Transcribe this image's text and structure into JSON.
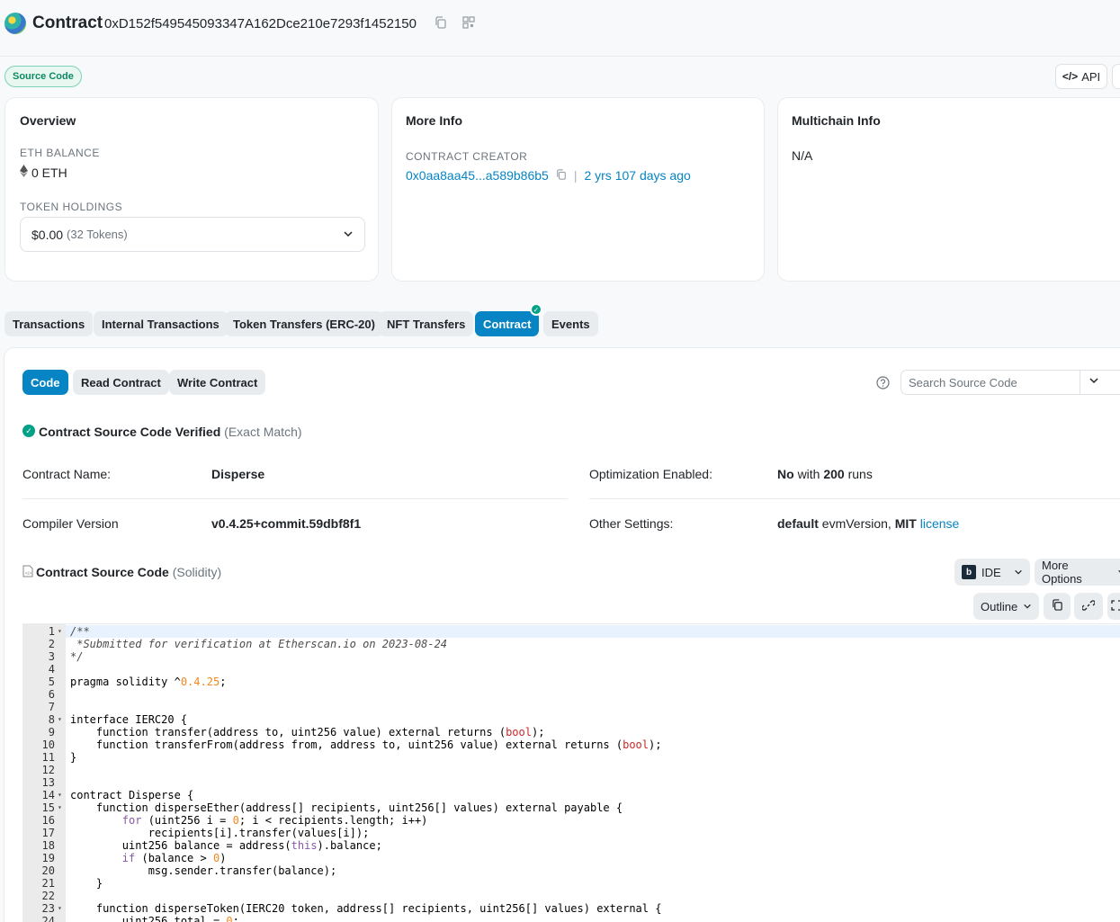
{
  "header": {
    "title": "Contract",
    "address": "0xD152f549545093347A162Dce210e7293f1452150"
  },
  "badge": {
    "source_code": "Source Code"
  },
  "api_button": {
    "label": "API"
  },
  "overview": {
    "title": "Overview",
    "eth_balance_label": "ETH BALANCE",
    "eth_balance_value": "0 ETH",
    "token_holdings_label": "TOKEN HOLDINGS",
    "token_holdings_value": "$0.00",
    "token_holdings_count": "(32 Tokens)"
  },
  "more_info": {
    "title": "More Info",
    "creator_label": "CONTRACT CREATOR",
    "creator_address": "0x0aa8aa45...a589b86b5",
    "separator": "|",
    "creator_age": "2 yrs 107 days ago"
  },
  "multichain": {
    "title": "Multichain Info",
    "value": "N/A"
  },
  "tabs": [
    {
      "label": "Transactions"
    },
    {
      "label": "Internal Transactions"
    },
    {
      "label": "Token Transfers (ERC-20)"
    },
    {
      "label": "NFT Transfers"
    },
    {
      "label": "Contract"
    },
    {
      "label": "Events"
    }
  ],
  "subtabs": [
    {
      "label": "Code"
    },
    {
      "label": "Read Contract"
    },
    {
      "label": "Write Contract"
    }
  ],
  "search": {
    "placeholder": "Search Source Code"
  },
  "verified": {
    "title": "Contract Source Code Verified",
    "match": "(Exact Match)"
  },
  "details": {
    "contract_name_label": "Contract Name:",
    "contract_name_value": "Disperse",
    "compiler_label": "Compiler Version",
    "compiler_value": "v0.4.25+commit.59dbf8f1",
    "optimization_label": "Optimization Enabled:",
    "optimization_no": "No",
    "optimization_with": "with",
    "optimization_runs": "200",
    "optimization_runs_suffix": "runs",
    "other_settings_label": "Other Settings:",
    "other_settings_default": "default",
    "other_settings_evm": "evmVersion,",
    "other_settings_mit": "MIT",
    "other_settings_license": "license"
  },
  "source_section": {
    "title": "Contract Source Code",
    "lang": "(Solidity)",
    "ide_label": "IDE",
    "more_options_label": "More Options",
    "outline_label": "Outline"
  },
  "code_lines": [
    "/**",
    " *Submitted for verification at Etherscan.io on 2023-08-24",
    "*/",
    "",
    "pragma solidity ^0.4.25;",
    "",
    "",
    "interface IERC20 {",
    "    function transfer(address to, uint256 value) external returns (bool);",
    "    function transferFrom(address from, address to, uint256 value) external returns (bool);",
    "}",
    "",
    "",
    "contract Disperse {",
    "    function disperseEther(address[] recipients, uint256[] values) external payable {",
    "        for (uint256 i = 0; i < recipients.length; i++)",
    "            recipients[i].transfer(values[i]);",
    "        uint256 balance = address(this).balance;",
    "        if (balance > 0)",
    "            msg.sender.transfer(balance);",
    "    }",
    "",
    "    function disperseToken(IERC20 token, address[] recipients, uint256[] values) external {",
    "        uint256 total = 0;"
  ],
  "fold_lines": [
    1,
    8,
    14,
    15,
    23
  ],
  "icons": {
    "copy": "copy-icon",
    "qr": "qr-icon",
    "eth": "eth-icon",
    "chevron": "chevron-down-icon",
    "help": "help-icon",
    "check": "check-icon",
    "doc": "document-icon",
    "link": "link-icon",
    "fullscreen": "fullscreen-icon"
  },
  "colors": {
    "accent": "#0784c3",
    "verified": "#00a186"
  }
}
